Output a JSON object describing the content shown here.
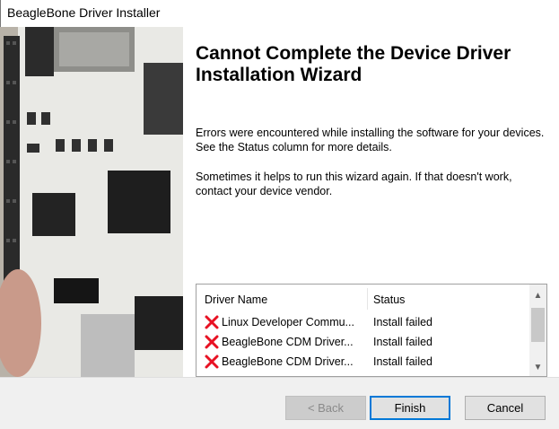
{
  "window": {
    "title": "BeagleBone Driver Installer"
  },
  "wizard": {
    "heading": "Cannot Complete the Device Driver Installation Wizard",
    "paragraph1": "Errors were encountered while installing the software for your devices. See the Status column for more details.",
    "paragraph2": "Sometimes it helps to run this wizard again. If that doesn't work, contact your device vendor."
  },
  "driver_list": {
    "columns": [
      "Driver Name",
      "Status"
    ],
    "rows": [
      {
        "name": "Linux Developer Commu...",
        "status": "Install failed"
      },
      {
        "name": "BeagleBone CDM Driver...",
        "status": "Install failed"
      },
      {
        "name": "BeagleBone CDM Driver...",
        "status": "Install failed"
      }
    ]
  },
  "buttons": {
    "back": "< Back",
    "finish": "Finish",
    "cancel": "Cancel"
  },
  "icons": {
    "row_status": "error-x-icon",
    "scroll_up": "chevron-up-icon",
    "scroll_down": "chevron-down-icon"
  },
  "colors": {
    "error": "#e81123",
    "accent": "#0078d7"
  }
}
